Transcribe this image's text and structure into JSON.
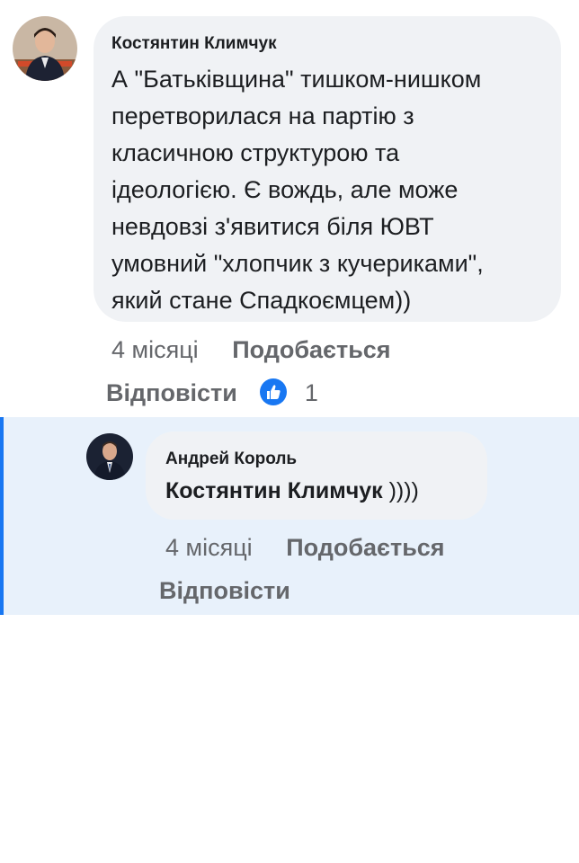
{
  "comment": {
    "author": "Костянтин Климчук",
    "lines": [
      "А \"Батьківщина\" тишком-нишком",
      "перетворилася на партію з",
      "класичною структурою та",
      "ідеологією. Є вождь, але може",
      "невдовзі з'явитися біля ЮВТ",
      "умовний \"хлопчик з кучериками\",",
      "який стане Спадкоємцем))"
    ],
    "time": "4 місяці",
    "like_label": "Подобається",
    "reply_label": "Відповісти",
    "reaction_count": "1",
    "reaction_icon": "thumbs-up-icon",
    "accent_color": "#1877f2"
  },
  "reply": {
    "author": "Андрей Король",
    "mention": "Костянтин Климчук",
    "text_suffix": " ))))",
    "time": "4 місяці",
    "like_label": "Подобається",
    "reply_label": "Відповісти"
  }
}
